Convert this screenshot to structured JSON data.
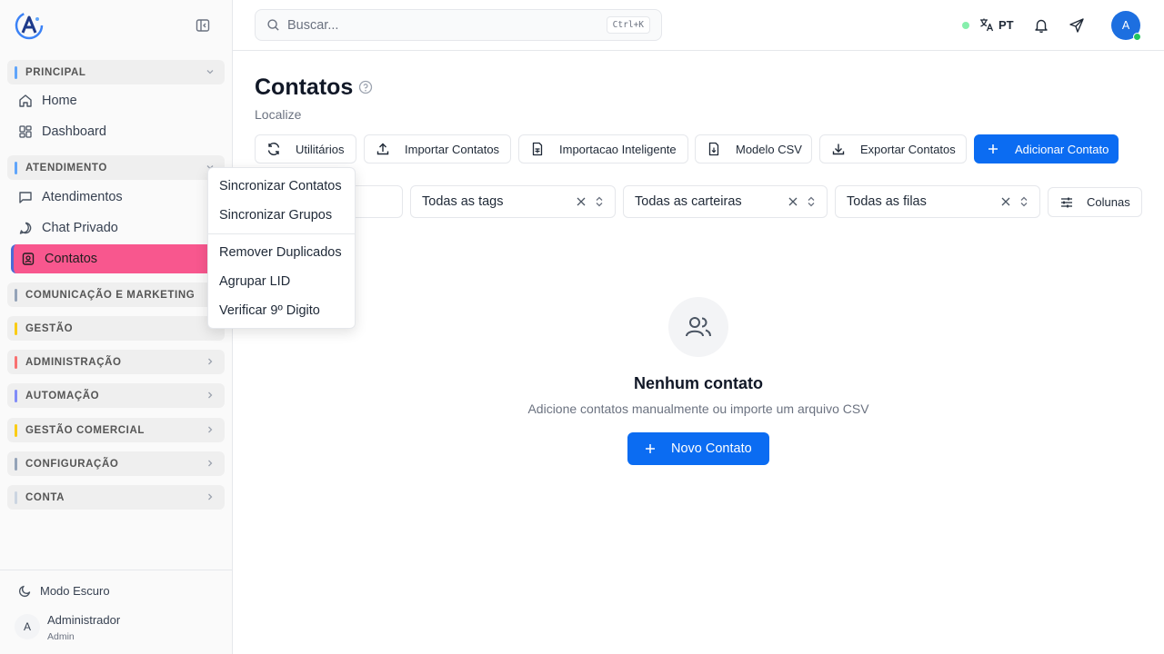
{
  "sidebar": {
    "groups": {
      "principal": {
        "label": "PRINCIPAL",
        "color": "#60a5fa"
      },
      "atendimento": {
        "label": "ATENDIMENTO",
        "color": "#60a5fa"
      },
      "comunicacao": {
        "label": "COMUNICAÇÃO E MARKETING",
        "color": "#94a3b8"
      },
      "gestao": {
        "label": "GESTÃO",
        "color": "#facc15"
      },
      "administracao": {
        "label": "ADMINISTRAÇÃO",
        "color": "#f87171"
      },
      "automacao": {
        "label": "AUTOMAÇÃO",
        "color": "#818cf8"
      },
      "gestao_comercial": {
        "label": "GESTÃO COMERCIAL",
        "color": "#facc15"
      },
      "configuracao": {
        "label": "CONFIGURAÇÃO",
        "color": "#94a3b8"
      },
      "conta": {
        "label": "CONTA",
        "color": "#cbd5e1"
      }
    },
    "items": {
      "home": "Home",
      "dashboard": "Dashboard",
      "atendimentos": "Atendimentos",
      "chat_privado": "Chat Privado",
      "contatos": "Contatos"
    },
    "footer": {
      "dark_mode": "Modo Escuro",
      "avatar_initial": "A",
      "user_name": "Administrador",
      "user_role": "Admin"
    }
  },
  "topbar": {
    "search_placeholder": "Buscar...",
    "shortcut": "Ctrl+K",
    "language": "PT",
    "avatar_initial": "A"
  },
  "main": {
    "title": "Contatos",
    "subtitle": "Localize",
    "toolbar": {
      "utilitarios": "Utilitários",
      "importar": "Importar Contatos",
      "importacao_inteligente": "Importacao Inteligente",
      "modelo_csv": "Modelo CSV",
      "exportar": "Exportar Contatos",
      "adicionar": "Adicionar Contato"
    },
    "filters": {
      "tags": "Todas as tags",
      "carteiras": "Todas as carteiras",
      "filas": "Todas as filas",
      "colunas": "Colunas"
    },
    "empty": {
      "title": "Nenhum contato",
      "description": "Adicione contatos manualmente ou importe um arquivo CSV",
      "button": "Novo Contato"
    }
  },
  "dropdown": {
    "items": [
      "Sincronizar Contatos",
      "Sincronizar Grupos",
      "Remover Duplicados",
      "Agrupar LID",
      "Verificar 9º Digito"
    ]
  },
  "colors": {
    "primary": "#0b6cf2",
    "active_item": "#f8578e",
    "online": "#22c55e"
  }
}
